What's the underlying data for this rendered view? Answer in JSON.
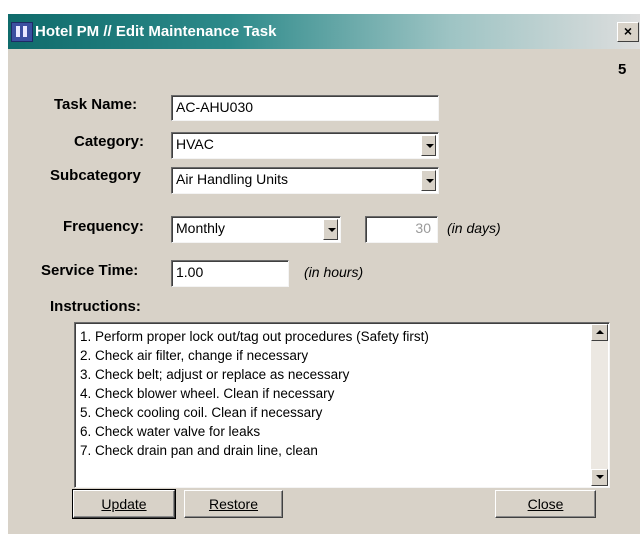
{
  "window": {
    "title": "Hotel PM // Edit Maintenance Task",
    "close_label": "×",
    "record_number": "5"
  },
  "form": {
    "task_name": {
      "label": "Task Name:",
      "value": "AC-AHU030"
    },
    "category": {
      "label": "Category:",
      "value": "HVAC"
    },
    "subcategory": {
      "label": "Subcategory",
      "value": "Air Handling Units"
    },
    "frequency": {
      "label": "Frequency:",
      "value": "Monthly",
      "days": "30",
      "days_note": "(in days)"
    },
    "service_time": {
      "label": "Service Time:",
      "value": "1.00",
      "note": "(in hours)"
    },
    "instructions": {
      "label": "Instructions:",
      "lines": [
        "1. Perform proper lock out/tag out procedures (Safety first)",
        "2. Check air filter, change if necessary",
        "3. Check belt; adjust or replace as necessary",
        "4. Check blower wheel.  Clean if necessary",
        "5. Check cooling coil.  Clean if necessary",
        "6. Check water valve for leaks",
        "7. Check drain pan and drain line, clean"
      ]
    }
  },
  "buttons": {
    "update": "Update",
    "restore": "Restore",
    "close": "Close"
  },
  "icons": {
    "app": "hotel-app-icon",
    "close": "close-icon",
    "dropdown": "chevron-down-icon",
    "scroll_up": "scroll-up-icon",
    "scroll_down": "scroll-down-icon"
  }
}
